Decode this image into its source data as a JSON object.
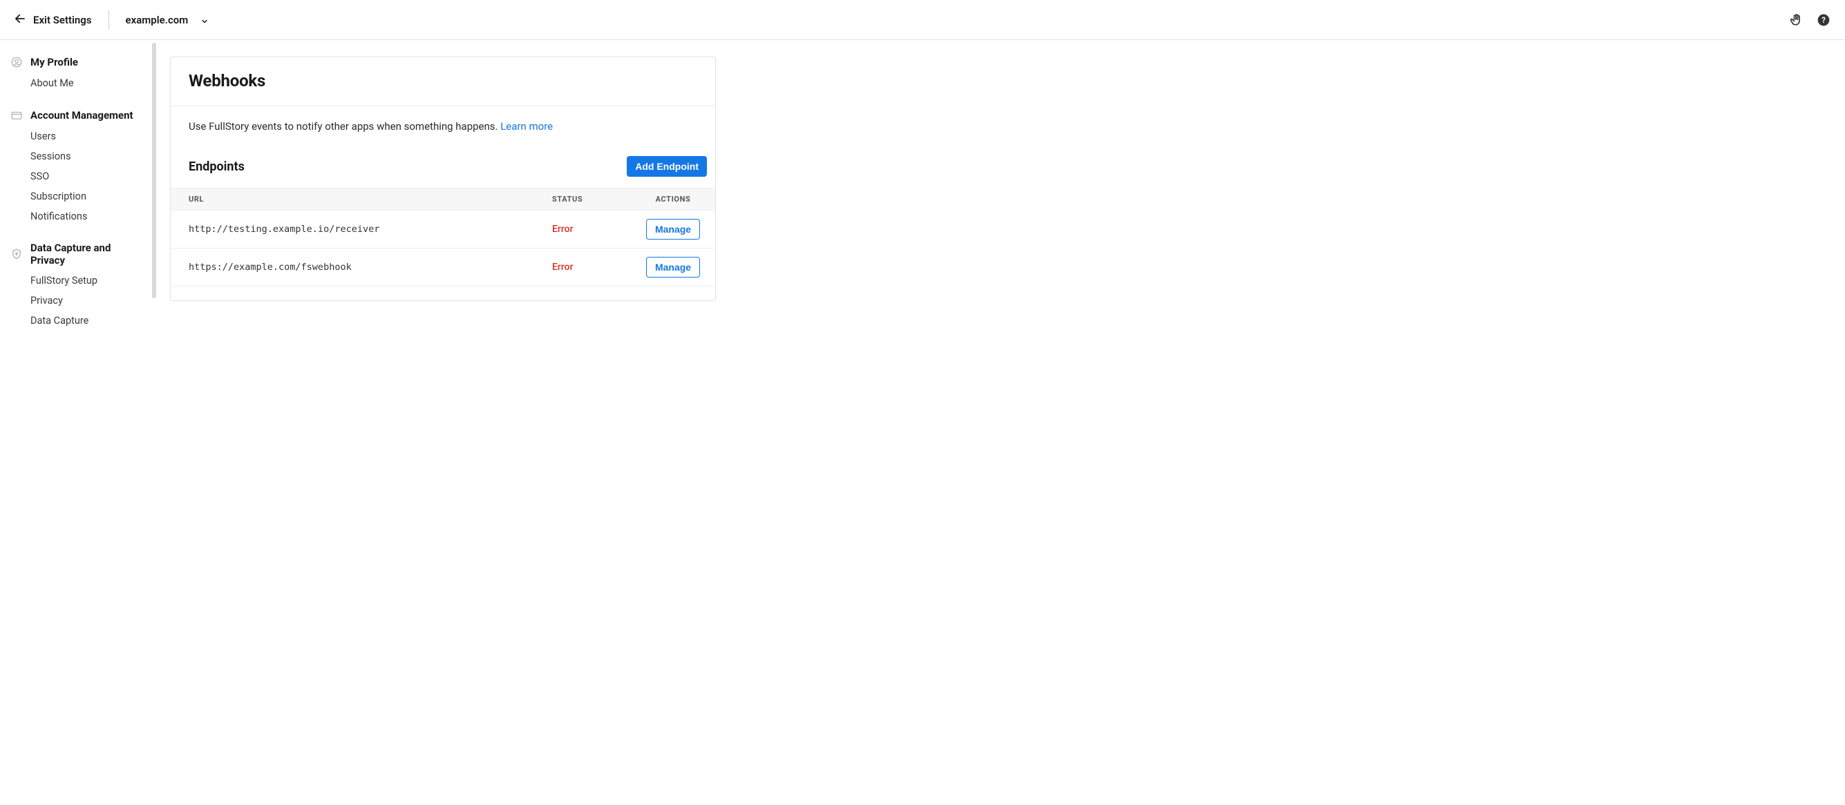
{
  "topbar": {
    "exit_label": "Exit Settings",
    "domain": "example.com"
  },
  "sidebar": {
    "profile": {
      "header": "My Profile",
      "items": [
        "About Me"
      ]
    },
    "account": {
      "header": "Account Management",
      "items": [
        "Users",
        "Sessions",
        "SSO",
        "Subscription",
        "Notifications"
      ]
    },
    "data": {
      "header": "Data Capture and Privacy",
      "items": [
        "FullStory Setup",
        "Privacy",
        "Data Capture"
      ]
    }
  },
  "main": {
    "title": "Webhooks",
    "description": "Use FullStory events to notify other apps when something happens. ",
    "learn_more": "Learn more",
    "endpoints_title": "Endpoints",
    "add_endpoint": "Add Endpoint",
    "table": {
      "headers": {
        "url": "URL",
        "status": "STATUS",
        "actions": "ACTIONS"
      },
      "rows": [
        {
          "url": "http://testing.example.io/receiver",
          "status": "Error",
          "action": "Manage"
        },
        {
          "url": "https://example.com/fswebhook",
          "status": "Error",
          "action": "Manage"
        }
      ]
    }
  }
}
